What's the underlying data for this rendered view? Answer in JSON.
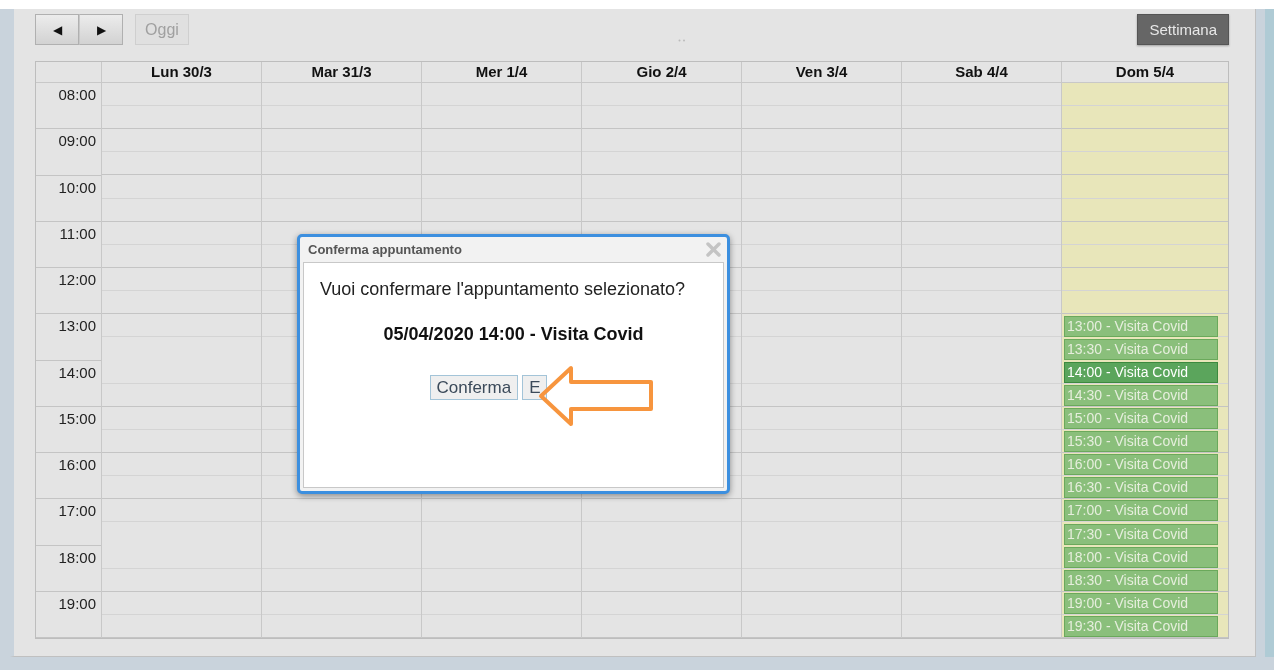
{
  "toolbar": {
    "prev": "◀",
    "next": "▶",
    "today": {
      "label": "Oggi",
      "disabled": true
    },
    "views": [
      {
        "label": "Settimana",
        "selected": true
      }
    ]
  },
  "calendar": {
    "days": [
      {
        "label": "Lun 30/3",
        "today": false
      },
      {
        "label": "Mar 31/3",
        "today": false
      },
      {
        "label": "Mer 1/4",
        "today": false
      },
      {
        "label": "Gio 2/4",
        "today": false
      },
      {
        "label": "Ven 3/4",
        "today": false
      },
      {
        "label": "Sab 4/4",
        "today": false
      },
      {
        "label": "Dom 5/4",
        "today": true,
        "events": [
          {
            "label": "13:00 - Visita Covid",
            "selected": false
          },
          {
            "label": "13:30 - Visita Covid",
            "selected": false
          },
          {
            "label": "14:00 - Visita Covid",
            "selected": true
          },
          {
            "label": "14:30 - Visita Covid",
            "selected": false
          },
          {
            "label": "15:00 - Visita Covid",
            "selected": false
          },
          {
            "label": "15:30 - Visita Covid",
            "selected": false
          },
          {
            "label": "16:00 - Visita Covid",
            "selected": false
          },
          {
            "label": "16:30 - Visita Covid",
            "selected": false
          },
          {
            "label": "17:00 - Visita Covid",
            "selected": false
          },
          {
            "label": "17:30 - Visita Covid",
            "selected": false
          },
          {
            "label": "18:00 - Visita Covid",
            "selected": false
          },
          {
            "label": "18:30 - Visita Covid",
            "selected": false
          },
          {
            "label": "19:00 - Visita Covid",
            "selected": false
          },
          {
            "label": "19:30 - Visita Covid",
            "selected": false
          }
        ]
      }
    ],
    "hours": [
      "08:00",
      "09:00",
      "10:00",
      "11:00",
      "12:00",
      "13:00",
      "14:00",
      "15:00",
      "16:00",
      "17:00",
      "18:00",
      "19:00"
    ]
  },
  "dialog": {
    "title": "Conferma appuntamento",
    "message": "Vuoi confermare l'appuntamento selezionato?",
    "detail": "05/04/2020 14:00 - Visita Covid",
    "buttons": [
      "Conferma",
      "E"
    ]
  }
}
